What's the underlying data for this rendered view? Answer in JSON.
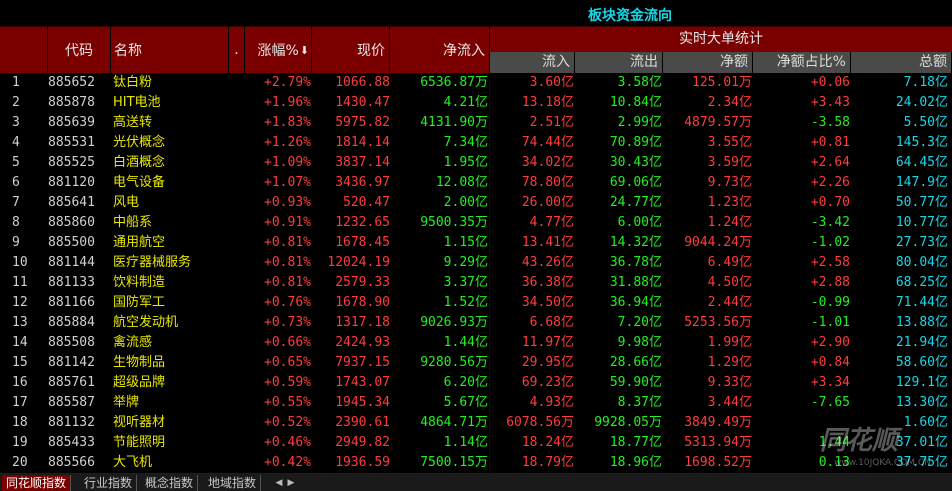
{
  "title": "板块资金流向",
  "headers": {
    "code": "代码",
    "name": "名称",
    "dot": ".",
    "pct": "涨幅%",
    "price": "现价",
    "net_in": "净流入",
    "group": "实时大单统计",
    "inflow": "流入",
    "outflow": "流出",
    "big_net": "净额",
    "net_ratio": "净额占比%",
    "total": "总额"
  },
  "rows": [
    {
      "idx": "1",
      "code": "885652",
      "name": "钛白粉",
      "pct": "+2.79%",
      "price": "1066.88",
      "net": "6536.87",
      "net_unit": "万",
      "in": "3.60",
      "out": "3.58",
      "bnet": "125.01",
      "bnet_unit": "万",
      "ratio": "+0.06",
      "total": "7.18",
      "total_unit": "亿",
      "ratio_up": true
    },
    {
      "idx": "2",
      "code": "885878",
      "name": "HIT电池",
      "pct": "+1.96%",
      "price": "1430.47",
      "net": "4.21",
      "net_unit": "亿",
      "in": "13.18",
      "out": "10.84",
      "bnet": "2.34",
      "bnet_unit": "亿",
      "ratio": "+3.43",
      "total": "24.02",
      "total_unit": "亿",
      "ratio_up": true
    },
    {
      "idx": "3",
      "code": "885639",
      "name": "高送转",
      "pct": "+1.83%",
      "price": "5975.82",
      "net": "4131.90",
      "net_unit": "万",
      "in": "2.51",
      "out": "2.99",
      "bnet": "4879.57",
      "bnet_unit": "万",
      "ratio": "-3.58",
      "total": "5.50",
      "total_unit": "亿",
      "ratio_up": false
    },
    {
      "idx": "4",
      "code": "885531",
      "name": "光伏概念",
      "pct": "+1.26%",
      "price": "1814.14",
      "net": "7.34",
      "net_unit": "亿",
      "in": "74.44",
      "out": "70.89",
      "bnet": "3.55",
      "bnet_unit": "亿",
      "ratio": "+0.81",
      "total": "145.3",
      "total_unit": "亿",
      "ratio_up": true
    },
    {
      "idx": "5",
      "code": "885525",
      "name": "白酒概念",
      "pct": "+1.09%",
      "price": "3837.14",
      "net": "1.95",
      "net_unit": "亿",
      "in": "34.02",
      "out": "30.43",
      "bnet": "3.59",
      "bnet_unit": "亿",
      "ratio": "+2.64",
      "total": "64.45",
      "total_unit": "亿",
      "ratio_up": true
    },
    {
      "idx": "6",
      "code": "881120",
      "name": "电气设备",
      "pct": "+1.07%",
      "price": "3436.97",
      "net": "12.08",
      "net_unit": "亿",
      "in": "78.80",
      "out": "69.06",
      "bnet": "9.73",
      "bnet_unit": "亿",
      "ratio": "+2.26",
      "total": "147.9",
      "total_unit": "亿",
      "ratio_up": true
    },
    {
      "idx": "7",
      "code": "885641",
      "name": "风电",
      "pct": "+0.93%",
      "price": "520.47",
      "net": "2.00",
      "net_unit": "亿",
      "in": "26.00",
      "out": "24.77",
      "bnet": "1.23",
      "bnet_unit": "亿",
      "ratio": "+0.70",
      "total": "50.77",
      "total_unit": "亿",
      "ratio_up": true
    },
    {
      "idx": "8",
      "code": "885860",
      "name": "中船系",
      "pct": "+0.91%",
      "price": "1232.65",
      "net": "9500.35",
      "net_unit": "万",
      "in": "4.77",
      "out": "6.00",
      "bnet": "1.24",
      "bnet_unit": "亿",
      "ratio": "-3.42",
      "total": "10.77",
      "total_unit": "亿",
      "ratio_up": false
    },
    {
      "idx": "9",
      "code": "885500",
      "name": "通用航空",
      "pct": "+0.81%",
      "price": "1678.45",
      "net": "1.15",
      "net_unit": "亿",
      "in": "13.41",
      "out": "14.32",
      "bnet": "9044.24",
      "bnet_unit": "万",
      "ratio": "-1.02",
      "total": "27.73",
      "total_unit": "亿",
      "ratio_up": false
    },
    {
      "idx": "10",
      "code": "881144",
      "name": "医疗器械服务",
      "pct": "+0.81%",
      "price": "12024.19",
      "net": "9.29",
      "net_unit": "亿",
      "in": "43.26",
      "out": "36.78",
      "bnet": "6.49",
      "bnet_unit": "亿",
      "ratio": "+2.58",
      "total": "80.04",
      "total_unit": "亿",
      "ratio_up": true
    },
    {
      "idx": "11",
      "code": "881133",
      "name": "饮料制造",
      "pct": "+0.81%",
      "price": "2579.33",
      "net": "3.37",
      "net_unit": "亿",
      "in": "36.38",
      "out": "31.88",
      "bnet": "4.50",
      "bnet_unit": "亿",
      "ratio": "+2.88",
      "total": "68.25",
      "total_unit": "亿",
      "ratio_up": true
    },
    {
      "idx": "12",
      "code": "881166",
      "name": "国防军工",
      "pct": "+0.76%",
      "price": "1678.90",
      "net": "1.52",
      "net_unit": "亿",
      "in": "34.50",
      "out": "36.94",
      "bnet": "2.44",
      "bnet_unit": "亿",
      "ratio": "-0.99",
      "total": "71.44",
      "total_unit": "亿",
      "ratio_up": false
    },
    {
      "idx": "13",
      "code": "885884",
      "name": "航空发动机",
      "pct": "+0.73%",
      "price": "1317.18",
      "net": "9026.93",
      "net_unit": "万",
      "in": "6.68",
      "out": "7.20",
      "bnet": "5253.56",
      "bnet_unit": "万",
      "ratio": "-1.01",
      "total": "13.88",
      "total_unit": "亿",
      "ratio_up": false
    },
    {
      "idx": "14",
      "code": "885508",
      "name": "禽流感",
      "pct": "+0.66%",
      "price": "2424.93",
      "net": "1.44",
      "net_unit": "亿",
      "in": "11.97",
      "out": "9.98",
      "bnet": "1.99",
      "bnet_unit": "亿",
      "ratio": "+2.90",
      "total": "21.94",
      "total_unit": "亿",
      "ratio_up": true
    },
    {
      "idx": "15",
      "code": "881142",
      "name": "生物制品",
      "pct": "+0.65%",
      "price": "7937.15",
      "net": "9280.56",
      "net_unit": "万",
      "in": "29.95",
      "out": "28.66",
      "bnet": "1.29",
      "bnet_unit": "亿",
      "ratio": "+0.84",
      "total": "58.60",
      "total_unit": "亿",
      "ratio_up": true
    },
    {
      "idx": "16",
      "code": "885761",
      "name": "超级品牌",
      "pct": "+0.59%",
      "price": "1743.07",
      "net": "6.20",
      "net_unit": "亿",
      "in": "69.23",
      "out": "59.90",
      "bnet": "9.33",
      "bnet_unit": "亿",
      "ratio": "+3.34",
      "total": "129.1",
      "total_unit": "亿",
      "ratio_up": true
    },
    {
      "idx": "17",
      "code": "885587",
      "name": "举牌",
      "pct": "+0.55%",
      "price": "1945.34",
      "net": "5.67",
      "net_unit": "亿",
      "in": "4.93",
      "out": "8.37",
      "bnet": "3.44",
      "bnet_unit": "亿",
      "ratio": "-7.65",
      "total": "13.30",
      "total_unit": "亿",
      "ratio_up": false
    },
    {
      "idx": "18",
      "code": "881132",
      "name": "视听器材",
      "pct": "+0.52%",
      "price": "2390.61",
      "net": "4864.71",
      "net_unit": "万",
      "in": "6078.56",
      "out": "9928.05",
      "bnet": "3849.49",
      "bnet_unit": "万",
      "ratio": "",
      "total": "1.60",
      "total_unit": "亿",
      "ratio_up": false,
      "in_unit": "万",
      "out_unit": "万"
    },
    {
      "idx": "19",
      "code": "885433",
      "name": "节能照明",
      "pct": "+0.46%",
      "price": "2949.82",
      "net": "1.14",
      "net_unit": "亿",
      "in": "18.24",
      "out": "18.77",
      "bnet": "5313.94",
      "bnet_unit": "万",
      "ratio": "1.44",
      "total": "37.01",
      "total_unit": "亿",
      "ratio_up": false
    },
    {
      "idx": "20",
      "code": "885566",
      "name": "大飞机",
      "pct": "+0.42%",
      "price": "1936.59",
      "net": "7500.15",
      "net_unit": "万",
      "in": "18.79",
      "out": "18.96",
      "bnet": "1698.52",
      "bnet_unit": "万",
      "ratio": "0.13",
      "total": "37.75",
      "total_unit": "亿",
      "ratio_up": false
    }
  ],
  "tabs": [
    "同花顺指数",
    "行业指数",
    "概念指数",
    "地域指数"
  ],
  "watermark": {
    "text": "同花顺",
    "url": "www.10JQKA.COM.CN"
  },
  "colors": {
    "up": "#ff3b3b",
    "down": "#22ee22",
    "name": "#e8e800",
    "total": "#18d6e8",
    "header_bg": "#7a0000"
  }
}
